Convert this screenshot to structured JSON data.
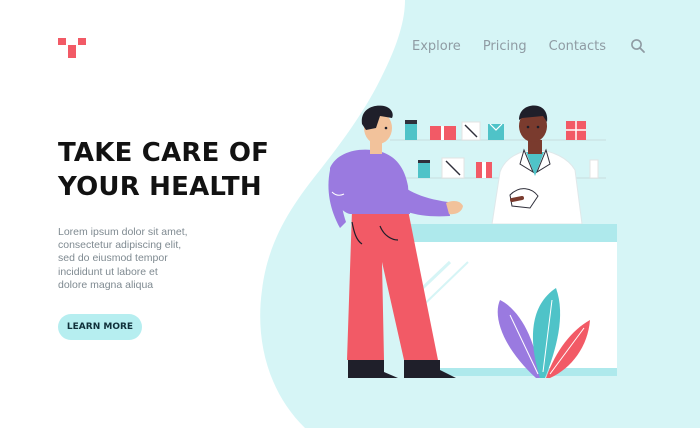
{
  "nav": {
    "items": [
      {
        "label": "Explore"
      },
      {
        "label": "Pricing"
      },
      {
        "label": "Contacts"
      }
    ],
    "search_icon": "search-icon"
  },
  "hero": {
    "title": "TAKE CARE OF\nYOUR HEALTH",
    "description": "Lorem ipsum dolor sit amet,\nconsectetur adipiscing elit,\nsed do eiusmod tempor\nincididunt ut labore et\ndolore magna aliqua",
    "cta_label": "LEARN MORE"
  },
  "colors": {
    "accent": "#f25a66",
    "background_blob": "#d6f5f6",
    "button": "#b6eef0",
    "nav_text": "#8f9ba3"
  }
}
